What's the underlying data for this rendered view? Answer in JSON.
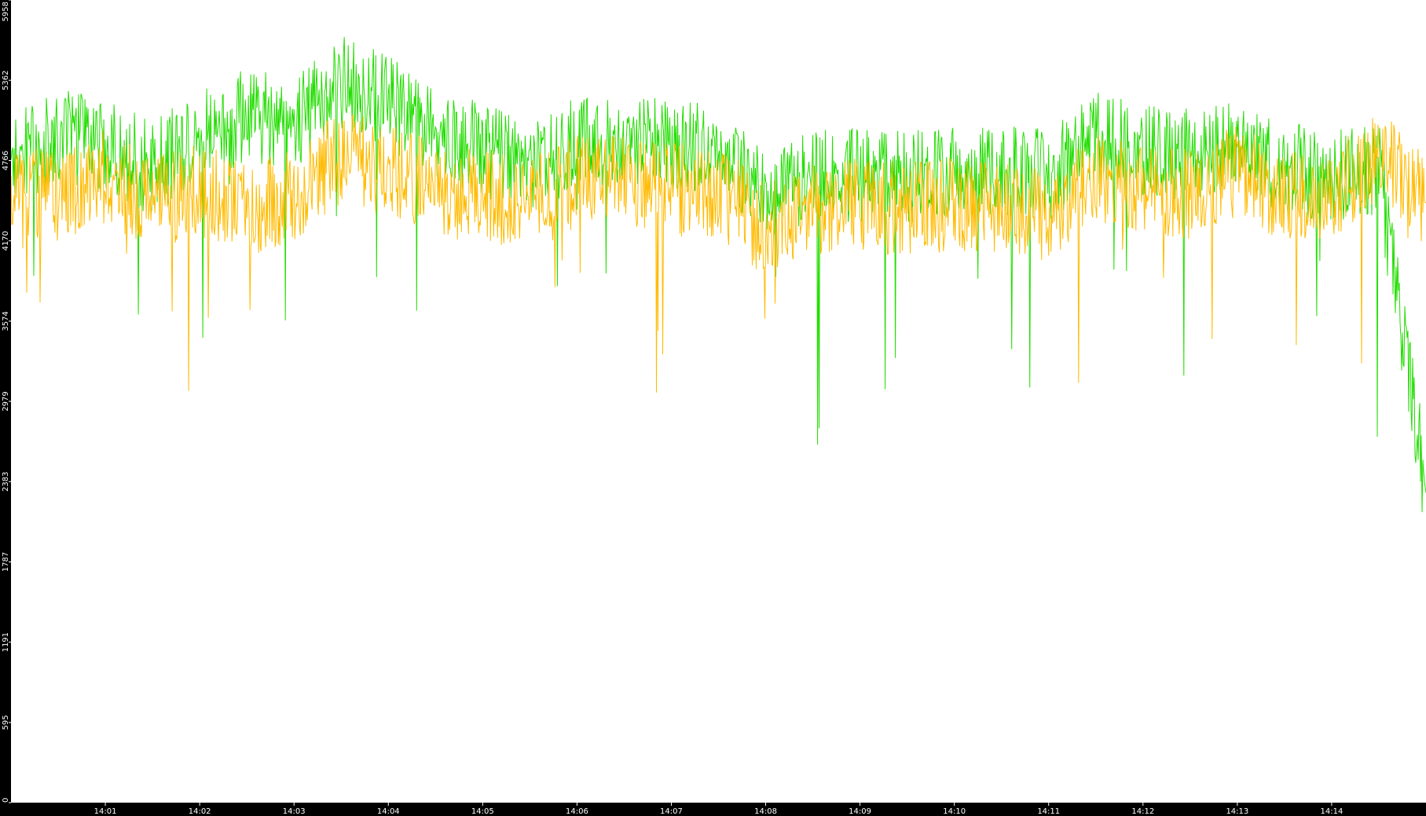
{
  "colors": {
    "background": "#ffffff",
    "axis_band": "#000000",
    "axis_text": "#ffffff",
    "series_green": "#22dd00",
    "series_orange": "#ffbb00"
  },
  "chart_data": {
    "type": "line",
    "title": "",
    "xlabel": "",
    "ylabel": "",
    "ylim": [
      0,
      5958
    ],
    "xlim": [
      "14:00",
      "14:15"
    ],
    "grid": false,
    "legend": "none",
    "y_ticks": [
      0,
      595,
      1191,
      1787,
      2383,
      2979,
      3574,
      4170,
      4766,
      5362,
      5958
    ],
    "x_ticks": [
      "14:01",
      "14:02",
      "14:03",
      "14:04",
      "14:05",
      "14:06",
      "14:07",
      "14:08",
      "14:09",
      "14:10",
      "14:11",
      "14:12",
      "14:13",
      "14:14"
    ],
    "series": [
      {
        "color": "#22dd00",
        "sample_interval": "approx. 1 per 0.5 s",
        "x": [
          "14:00",
          "14:00:30",
          "14:01",
          "14:01:30",
          "14:02",
          "14:02:30",
          "14:03",
          "14:03:30",
          "14:04",
          "14:04:30",
          "14:05",
          "14:05:30",
          "14:06",
          "14:06:30",
          "14:07",
          "14:07:30",
          "14:08",
          "14:08:30",
          "14:09",
          "14:09:30",
          "14:10",
          "14:10:30",
          "14:11",
          "14:11:30",
          "14:12",
          "14:12:30",
          "14:13",
          "14:13:30",
          "14:14",
          "14:14:30",
          "14:15"
        ],
        "values": [
          4750,
          4950,
          4900,
          4700,
          4950,
          5100,
          5050,
          5350,
          5200,
          4950,
          4850,
          4700,
          4900,
          4950,
          4850,
          4850,
          4550,
          4650,
          4650,
          4650,
          4700,
          4700,
          4650,
          4950,
          4850,
          4800,
          4950,
          4700,
          4650,
          4700,
          2300
        ]
      },
      {
        "color": "#ffbb00",
        "sample_interval": "approx. 1 per 0.5 s",
        "x": [
          "14:00",
          "14:00:30",
          "14:01",
          "14:01:30",
          "14:02",
          "14:02:30",
          "14:03",
          "14:03:30",
          "14:04",
          "14:04:30",
          "14:05",
          "14:05:30",
          "14:06",
          "14:06:30",
          "14:07",
          "14:07:30",
          "14:08",
          "14:08:30",
          "14:09",
          "14:09:30",
          "14:10",
          "14:10:30",
          "14:11",
          "14:11:30",
          "14:12",
          "14:12:30",
          "14:13",
          "14:13:30",
          "14:14",
          "14:14:30",
          "14:15"
        ],
        "values": [
          4550,
          4500,
          4650,
          4450,
          4550,
          4400,
          4500,
          4800,
          4700,
          4550,
          4500,
          4450,
          4600,
          4650,
          4550,
          4550,
          4250,
          4400,
          4450,
          4400,
          4450,
          4400,
          4350,
          4650,
          4550,
          4500,
          4700,
          4500,
          4500,
          4800,
          4450
        ]
      }
    ]
  }
}
